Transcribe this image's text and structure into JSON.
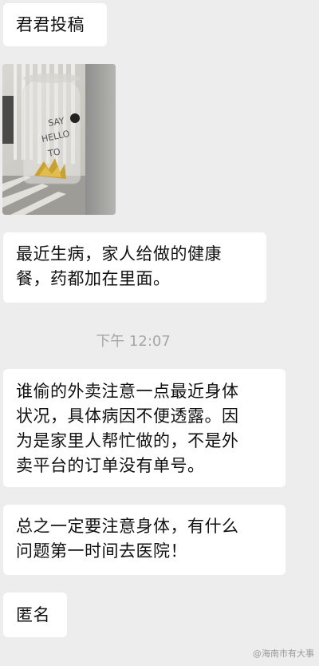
{
  "messages": [
    {
      "text": "君君投稿"
    },
    {
      "text": "最近生病，家人给做的健康\n餐，药都加在里面。"
    },
    {
      "text": "谁偷的外卖注意一点最近身体\n状况，具体病因不便透露。因\n为是家里人帮忙做的，不是外\n卖平台的订单没有单号。"
    },
    {
      "text": "总之一定要注意身体，有什么\n问题第一时间去医院！"
    },
    {
      "text": "匿名"
    }
  ],
  "timestamp": "下午 12:07",
  "photo": {
    "sticker_text": "SAY HELLO TO",
    "description_icon": "photo-image"
  },
  "watermark": "@海南市有大事"
}
